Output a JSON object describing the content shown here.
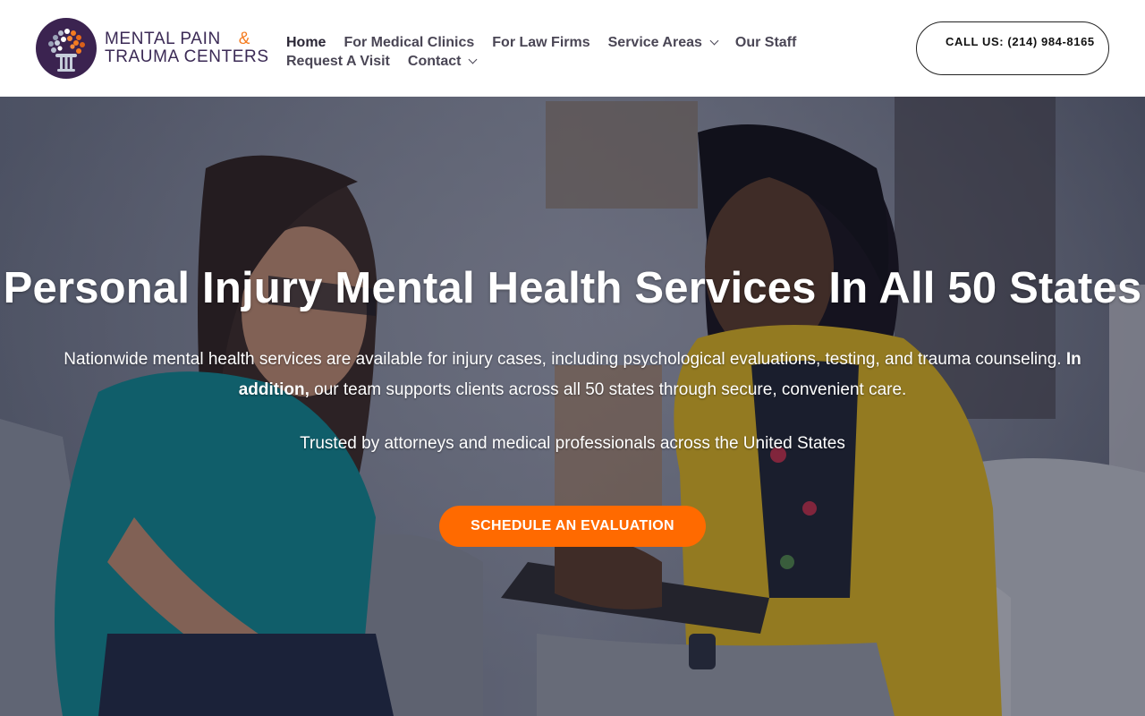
{
  "brand": {
    "line1": "MENTAL PAIN",
    "ampersand": "&",
    "line2": "TRAUMA CENTERS",
    "logo_icon": "brain-pillar-logo",
    "colors": {
      "purple": "#3b2a55",
      "orange": "#f47b20"
    }
  },
  "nav": {
    "items": [
      {
        "label": "Home",
        "active": true
      },
      {
        "label": "For Medical Clinics"
      },
      {
        "label": "For Law Firms"
      },
      {
        "label": "Service Areas",
        "dropdown": true
      },
      {
        "label": "Our Staff"
      },
      {
        "label": "Request A Visit"
      },
      {
        "label": "Contact",
        "dropdown": true
      }
    ]
  },
  "call": {
    "label": "CALL US: (214) 984-8165"
  },
  "hero": {
    "title": "Personal Injury Mental Health Services In All 50 States",
    "desc_part1": "Nationwide mental health services are available for injury cases, including psychological evaluations, testing, and trauma counseling. ",
    "desc_bold": "In addition,",
    "desc_part2": " our team supports clients across all 50 states through secure, convenient care.",
    "trust": "Trusted by attorneys and medical professionals across the United States",
    "cta": "SCHEDULE AN EVALUATION",
    "background_image": "therapist-counseling-client-photo"
  },
  "colors": {
    "accent": "#ff6a00",
    "text_dark": "#4a4655"
  }
}
